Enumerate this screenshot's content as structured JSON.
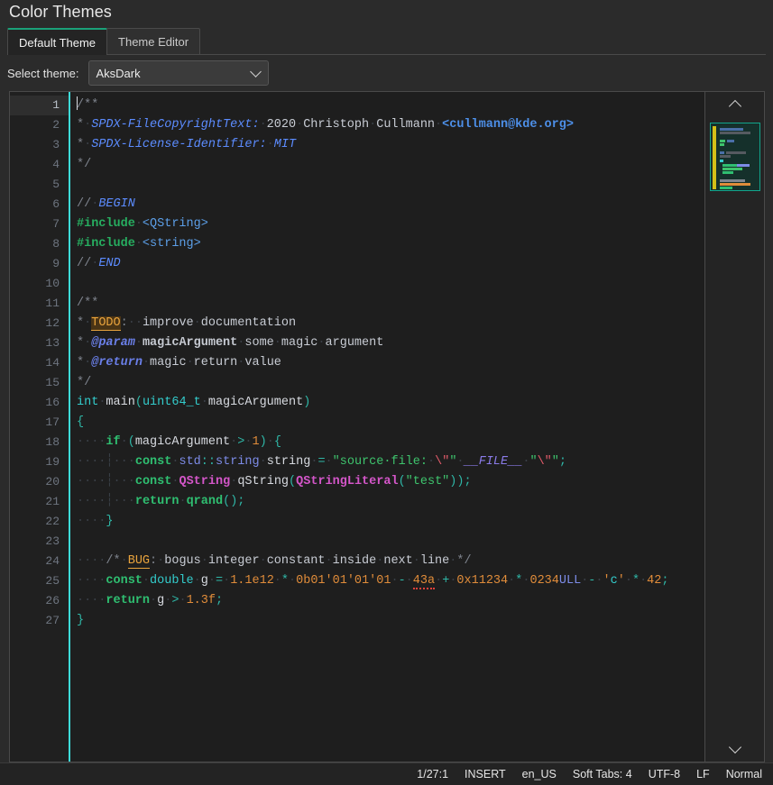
{
  "window": {
    "title": "Color Themes"
  },
  "tabs": [
    {
      "label": "Default Theme",
      "active": true
    },
    {
      "label": "Theme Editor",
      "active": false
    }
  ],
  "theme_selector": {
    "label": "Select theme:",
    "value": "AksDark",
    "icon": "chevron-down-icon"
  },
  "editor": {
    "language": "C++",
    "total_lines": 27,
    "current_line": 1,
    "line_numbers": [
      1,
      2,
      3,
      4,
      5,
      6,
      7,
      8,
      9,
      10,
      11,
      12,
      13,
      14,
      15,
      16,
      17,
      18,
      19,
      20,
      21,
      22,
      23,
      24,
      25,
      26,
      27
    ],
    "lines": [
      "/**",
      " * SPDX-FileCopyrightText: 2020 Christoph Cullmann <cullmann@kde.org>",
      " * SPDX-License-Identifier: MIT",
      " */",
      "",
      "// BEGIN",
      "#include <QString>",
      "#include <string>",
      "// END",
      "",
      "/**",
      " * TODO: improve documentation",
      " * @param magicArgument some magic argument",
      " * @return magic return value",
      " */",
      "int main(uint64_t magicArgument)",
      "{",
      "    if (magicArgument > 1) {",
      "        const std::string string = \"source file: \\\"\" __FILE__ \"\\\"\";",
      "        const QString qString(QStringLiteral(\"test\"));",
      "        return qrand();",
      "    }",
      "",
      "    /* BUG: bogus integer constant inside next line */",
      "    const double g = 1.1e12 * 0b01'01'01'01 - 43a + 0x11234 * 0234ULL - 'c' * 42;",
      "    return g > 1.3f;",
      "}"
    ]
  },
  "scrollbar": {
    "up_icon": "chevron-up-icon",
    "down_icon": "chevron-down-icon"
  },
  "statusbar": {
    "position": "1/27:1",
    "mode": "INSERT",
    "locale": "en_US",
    "tabs": "Soft Tabs: 4",
    "encoding": "UTF-8",
    "eol": "LF",
    "state": "Normal"
  },
  "colors": {
    "accent": "#1aa179",
    "background": "#2b2b2b",
    "editor_background": "#1e1e1e",
    "gutter_background": "#202020",
    "fold_marker": "#3ddbd9",
    "modified_marker": "#d4c018",
    "minimap_border": "#12a58c"
  }
}
